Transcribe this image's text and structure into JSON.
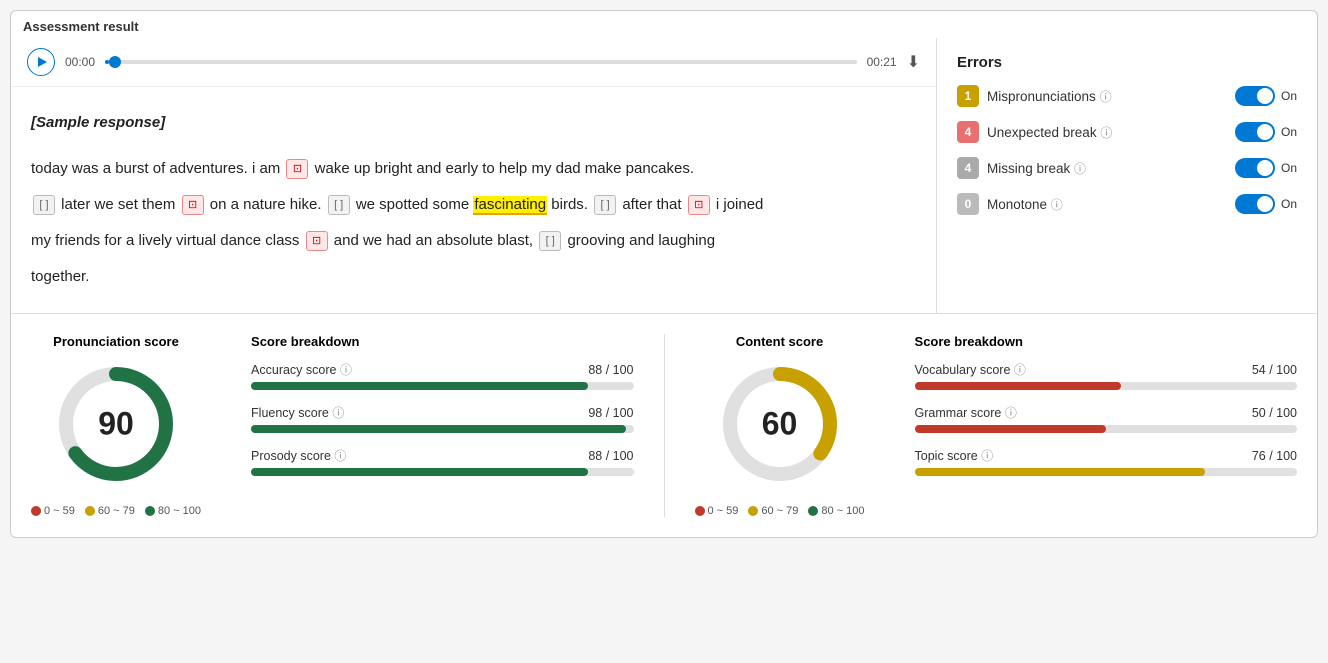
{
  "page": {
    "title": "Assessment result"
  },
  "audio": {
    "time_start": "00:00",
    "time_end": "00:21",
    "progress_percent": 2
  },
  "sample_text": {
    "label": "[Sample response]",
    "sentence1": "today was a burst of adventures. i am",
    "word1_type": "error",
    "sentence2": "wake up bright and early to help my dad make pancakes.",
    "sentence3": "later we set them",
    "word2_type": "error",
    "sentence4": "on a nature hike.",
    "word3_type": "missing",
    "sentence5": "we spotted some",
    "word_highlight": "fascinating",
    "sentence6": "birds.",
    "word4_type": "missing",
    "sentence7": "after that",
    "word5_type": "error",
    "sentence8": "i joined",
    "sentence9": "my friends for a lively virtual dance class",
    "word6_type": "error",
    "sentence10": "and we had an absolute blast,",
    "word7_type": "missing",
    "sentence11": "grooving and laughing",
    "sentence12": "together."
  },
  "errors": {
    "title": "Errors",
    "items": [
      {
        "count": 1,
        "label": "Mispronunciations",
        "badge_color": "yellow",
        "toggle": "On"
      },
      {
        "count": 4,
        "label": "Unexpected break",
        "badge_color": "pink",
        "toggle": "On"
      },
      {
        "count": 4,
        "label": "Missing break",
        "badge_color": "gray",
        "toggle": "On"
      },
      {
        "count": 0,
        "label": "Monotone",
        "badge_color": "zero",
        "toggle": "On"
      }
    ]
  },
  "pronunciation": {
    "title": "Pronunciation score",
    "score": 90,
    "donut": {
      "green_percent": 90,
      "gray_percent": 10
    },
    "legend": [
      {
        "range": "0 ~ 59",
        "color": "red"
      },
      {
        "range": "60 ~ 79",
        "color": "yellow"
      },
      {
        "range": "80 ~ 100",
        "color": "green"
      }
    ],
    "breakdown": {
      "title": "Score breakdown",
      "items": [
        {
          "label": "Accuracy score",
          "value": "88 / 100",
          "percent": 88,
          "color": "green"
        },
        {
          "label": "Fluency score",
          "value": "98 / 100",
          "percent": 98,
          "color": "green"
        },
        {
          "label": "Prosody score",
          "value": "88 / 100",
          "percent": 88,
          "color": "green"
        }
      ]
    }
  },
  "content": {
    "title": "Content score",
    "score": 60,
    "donut": {
      "yellow_percent": 60,
      "gray_percent": 40
    },
    "legend": [
      {
        "range": "0 ~ 59",
        "color": "red"
      },
      {
        "range": "60 ~ 79",
        "color": "yellow"
      },
      {
        "range": "80 ~ 100",
        "color": "green"
      }
    ],
    "breakdown": {
      "title": "Score breakdown",
      "items": [
        {
          "label": "Vocabulary score",
          "value": "54 / 100",
          "percent": 54,
          "color": "red"
        },
        {
          "label": "Grammar score",
          "value": "50 / 100",
          "percent": 50,
          "color": "red"
        },
        {
          "label": "Topic score",
          "value": "76 / 100",
          "percent": 76,
          "color": "yellow"
        }
      ]
    }
  },
  "icons": {
    "play": "▶",
    "download": "⬇",
    "info": "ⓘ"
  }
}
